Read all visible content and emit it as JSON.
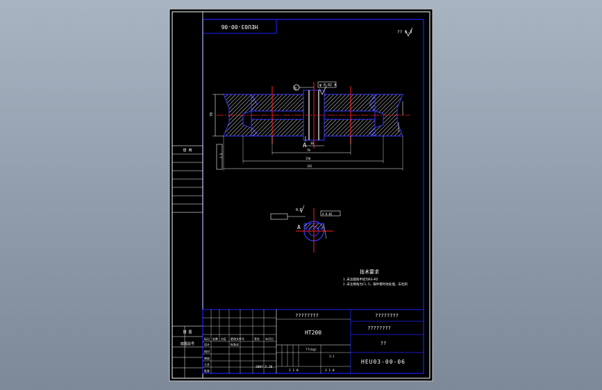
{
  "viewer": {
    "background_color": "#8f9bab",
    "paper_color": "#000000"
  },
  "colors": {
    "frame": "#ffffff",
    "border": "#1f1fff",
    "part_line": "#3a3aff",
    "hatch": "#ffffff",
    "center_line": "#ff2020",
    "title_text": "#ffffff",
    "dim_text": "#ffffff"
  },
  "drawing": {
    "code_box_text": "HEU03-00-06",
    "roughness_mark": "?? 6.3",
    "label_a_front": "A",
    "label_a_side": "A",
    "datum_symbol": "◎",
    "dim_values": {
      "top_tolerance": "φ 0.02 A",
      "height_left": "70",
      "dim_30": "30",
      "dim_70": "70",
      "dim_150": "150",
      "dim_192": "192",
      "dim_left_vertical": "2 X",
      "side_tol_left": "0.2",
      "side_tol_right": "A 0.02"
    },
    "tech_requirements": {
      "title": "技术要求",
      "lines": [
        "1.未注圆角半径为R3~R5",
        "2.未注倒角为C1.5，铸件需时效处理，去毛刺"
      ]
    }
  },
  "left_strip": {
    "label_top": "借 用",
    "label_bottom_1": "描 图",
    "label_bottom_2": "底图总号"
  },
  "title_block": {
    "header_center": "????????",
    "header_right": "????????",
    "material": "HT200",
    "drawing_name": "????????",
    "company": "??",
    "drawing_number": "HEU03-00-06",
    "date": "2007.5.20",
    "scale_label": "??(kg)",
    "scale_value": "1:1",
    "sheet": "2 1 0",
    "sheets_total": "3 1 0",
    "row_labels": [
      "标记",
      "处数",
      "分区",
      "更改文件号",
      "签名",
      "年月日"
    ],
    "sign_labels": [
      "设计",
      "校对",
      "审核",
      "工艺",
      "标准化",
      "批准"
    ]
  }
}
